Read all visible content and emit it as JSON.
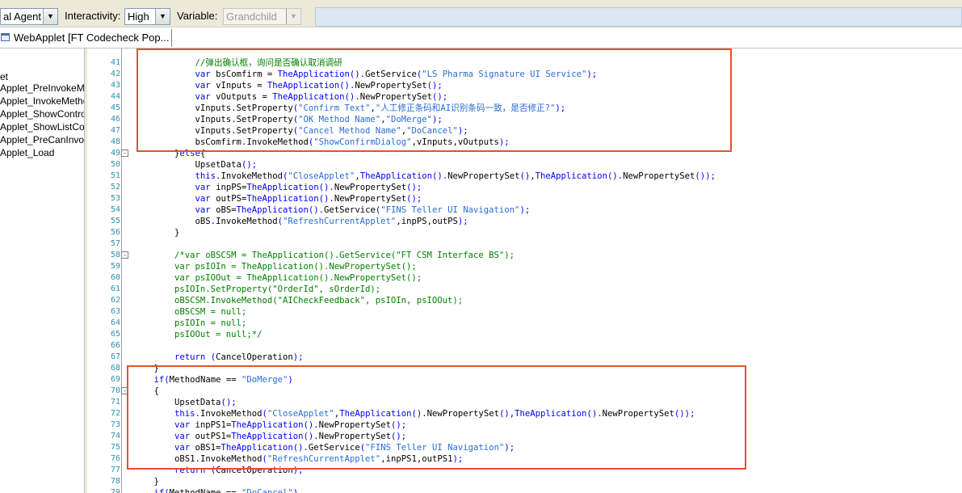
{
  "toolbar": {
    "agent_combo_value": "al Agent",
    "interactivity_label": "Interactivity:",
    "interactivity_value": "High",
    "variable_label": "Variable:",
    "variable_value": "Grandchild"
  },
  "tab": {
    "title": "WebApplet [FT Codecheck Pop..."
  },
  "tree": {
    "items": [
      "et",
      "Applet_PreInvokeMeth",
      "Applet_InvokeMethod",
      "Applet_ShowControl",
      "Applet_ShowListColum",
      "Applet_PreCanInvoke",
      "Applet_Load"
    ]
  },
  "code": {
    "lines": [
      {
        "n": "41",
        "fold": "",
        "text": "            //弹出确认框，询问是否确认取消调研"
      },
      {
        "n": "42",
        "fold": "",
        "text": "            var bsComfirm = TheApplication().GetService(\"LS Pharma Signature UI Service\");"
      },
      {
        "n": "43",
        "fold": "",
        "text": "            var vInputs = TheApplication().NewPropertySet();"
      },
      {
        "n": "44",
        "fold": "",
        "text": "            var vOutputs = TheApplication().NewPropertySet();"
      },
      {
        "n": "45",
        "fold": "",
        "text": "            vInputs.SetProperty(\"Confirm Text\",\"人工修正条码和AI识别条码一致，是否修正?\");"
      },
      {
        "n": "46",
        "fold": "",
        "text": "            vInputs.SetProperty(\"OK Method Name\",\"DoMerge\");"
      },
      {
        "n": "47",
        "fold": "",
        "text": "            vInputs.SetProperty(\"Cancel Method Name\",\"DoCancel\");"
      },
      {
        "n": "48",
        "fold": "",
        "text": "            bsComfirm.InvokeMethod(\"ShowConfirmDialog\",vInputs,vOutputs);"
      },
      {
        "n": "49",
        "fold": "-",
        "text": "        }else{"
      },
      {
        "n": "50",
        "fold": "",
        "text": "            UpsetData();"
      },
      {
        "n": "51",
        "fold": "",
        "text": "            this.InvokeMethod(\"CloseApplet\",TheApplication().NewPropertySet(),TheApplication().NewPropertySet());"
      },
      {
        "n": "52",
        "fold": "",
        "text": "            var inpPS=TheApplication().NewPropertySet();"
      },
      {
        "n": "53",
        "fold": "",
        "text": "            var outPS=TheApplication().NewPropertySet();"
      },
      {
        "n": "54",
        "fold": "",
        "text": "            var oBS=TheApplication().GetService(\"FINS Teller UI Navigation\");"
      },
      {
        "n": "55",
        "fold": "",
        "text": "            oBS.InvokeMethod(\"RefreshCurrentApplet\",inpPS,outPS);"
      },
      {
        "n": "56",
        "fold": "",
        "text": "        }"
      },
      {
        "n": "57",
        "fold": "",
        "text": ""
      },
      {
        "n": "58",
        "fold": "-",
        "text": "        /*var oBSCSM = TheApplication().GetService(\"FT CSM Interface BS\");"
      },
      {
        "n": "59",
        "fold": "",
        "text": "        var psIOIn = TheApplication().NewPropertySet();"
      },
      {
        "n": "60",
        "fold": "",
        "text": "        var psIOOut = TheApplication().NewPropertySet();"
      },
      {
        "n": "61",
        "fold": "",
        "text": "        psIOIn.SetProperty(\"OrderId\", sOrderId);"
      },
      {
        "n": "62",
        "fold": "",
        "text": "        oBSCSM.InvokeMethod(\"AICheckFeedback\", psIOIn, psIOOut);"
      },
      {
        "n": "63",
        "fold": "",
        "text": "        oBSCSM = null;"
      },
      {
        "n": "64",
        "fold": "",
        "text": "        psIOIn = null;"
      },
      {
        "n": "65",
        "fold": "",
        "text": "        psIOOut = null;*/"
      },
      {
        "n": "66",
        "fold": "",
        "text": ""
      },
      {
        "n": "67",
        "fold": "",
        "text": "        return (CancelOperation);"
      },
      {
        "n": "68",
        "fold": "",
        "text": "    }"
      },
      {
        "n": "69",
        "fold": "",
        "text": "    if(MethodName == \"DoMerge\")"
      },
      {
        "n": "70",
        "fold": "-",
        "text": "    {"
      },
      {
        "n": "71",
        "fold": "",
        "text": "        UpsetData();"
      },
      {
        "n": "72",
        "fold": "",
        "text": "        this.InvokeMethod(\"CloseApplet\",TheApplication().NewPropertySet(),TheApplication().NewPropertySet());"
      },
      {
        "n": "73",
        "fold": "",
        "text": "        var inpPS1=TheApplication().NewPropertySet();"
      },
      {
        "n": "74",
        "fold": "",
        "text": "        var outPS1=TheApplication().NewPropertySet();"
      },
      {
        "n": "75",
        "fold": "",
        "text": "        var oBS1=TheApplication().GetService(\"FINS Teller UI Navigation\");"
      },
      {
        "n": "76",
        "fold": "",
        "text": "        oBS1.InvokeMethod(\"RefreshCurrentApplet\",inpPS1,outPS1);"
      },
      {
        "n": "77",
        "fold": "",
        "text": "        return (CancelOperation);"
      },
      {
        "n": "78",
        "fold": "",
        "text": "    }"
      },
      {
        "n": "79",
        "fold": "",
        "text": "    if(MethodName == \"DoCancel\")"
      }
    ]
  },
  "colors": {
    "keyword": "#0000ff",
    "string": "#2a6dd6",
    "comment": "#008000",
    "line_number": "#2b91af",
    "highlight_box": "#e8502c"
  }
}
